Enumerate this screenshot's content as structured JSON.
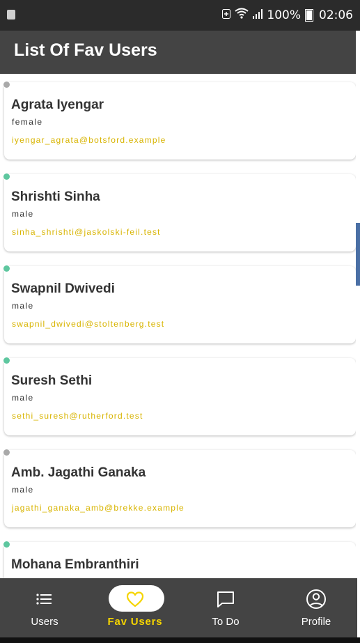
{
  "status_bar": {
    "battery_percent": "100%",
    "time": "02:06"
  },
  "app_bar": {
    "title": "List Of Fav Users"
  },
  "users": [
    {
      "name": "Agrata Iyengar",
      "gender": "female",
      "email": "iyengar_agrata@botsford.example",
      "status_color": "#a9a9a9"
    },
    {
      "name": "Shrishti Sinha",
      "gender": "male",
      "email": "sinha_shrishti@jaskolski-feil.test",
      "status_color": "#5ec79f"
    },
    {
      "name": "Swapnil Dwivedi",
      "gender": "male",
      "email": "swapnil_dwivedi@stoltenberg.test",
      "status_color": "#5ec79f"
    },
    {
      "name": "Suresh Sethi",
      "gender": "male",
      "email": "sethi_suresh@rutherford.test",
      "status_color": "#5ec79f"
    },
    {
      "name": "Amb. Jagathi Ganaka",
      "gender": "male",
      "email": "jagathi_ganaka_amb@brekke.example",
      "status_color": "#a9a9a9"
    },
    {
      "name": "Mohana Embranthiri",
      "gender": "",
      "email": "",
      "status_color": "#5ec79f"
    }
  ],
  "bottom_nav": {
    "items": [
      {
        "label": "Users",
        "icon": "list-icon"
      },
      {
        "label": "Fav Users",
        "icon": "heart-icon",
        "active": true
      },
      {
        "label": "To Do",
        "icon": "chat-bubble-icon"
      },
      {
        "label": "Profile",
        "icon": "account-circle-icon"
      }
    ]
  },
  "colors": {
    "app_bar": "#444444",
    "accent": "#f5d400",
    "online": "#5ec79f",
    "offline": "#a9a9a9"
  }
}
